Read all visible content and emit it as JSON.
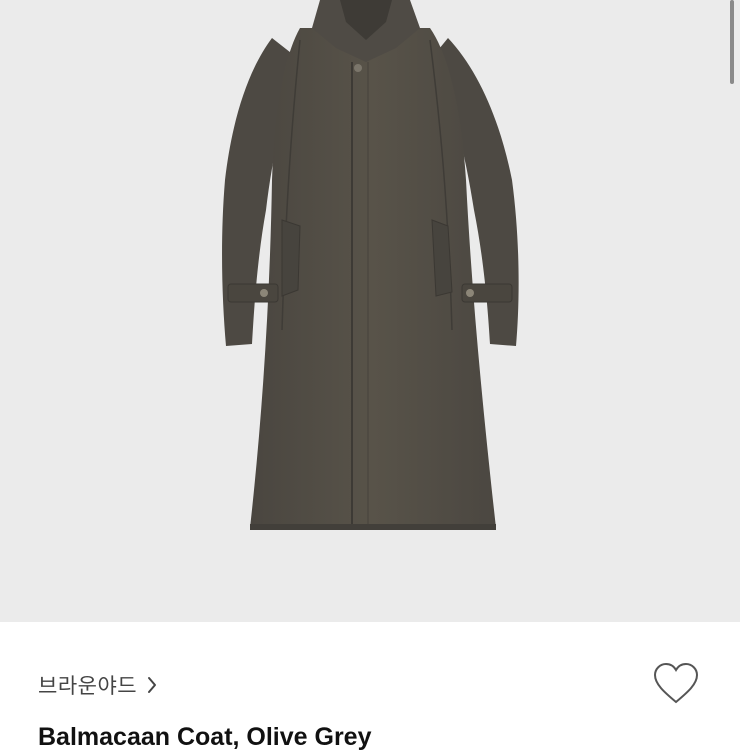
{
  "product": {
    "image_alt": "Balmacaan Coat, Olive Grey",
    "brand": "브라운야드",
    "title": "Balmacaan Coat, Olive Grey",
    "liked": false
  },
  "icons": {
    "brand_link": "chevron-right-icon",
    "like": "heart-outline-icon"
  },
  "colors": {
    "image_background": "#ebebeb",
    "coat": "#534f48",
    "text_primary": "#111111",
    "text_secondary": "#444444"
  }
}
